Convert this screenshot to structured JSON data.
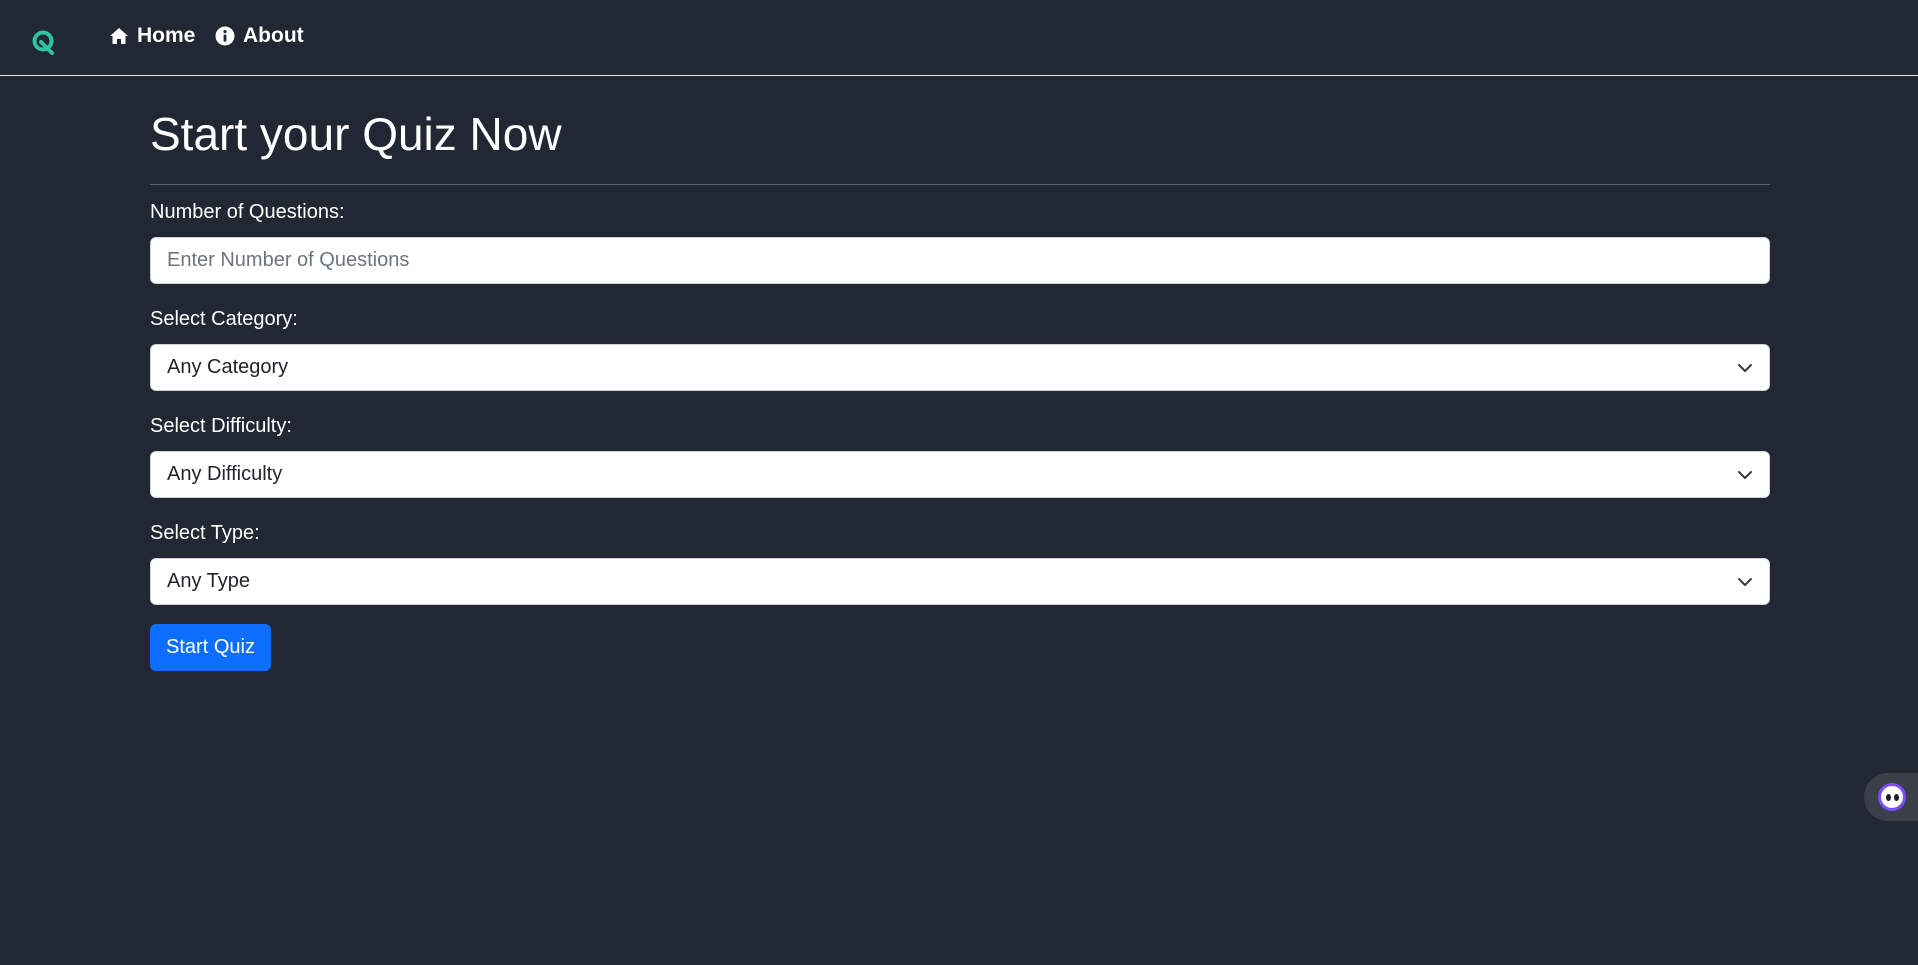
{
  "nav": {
    "logo_icon": "quiz-logo-icon",
    "brand_color": "#2ec4a0",
    "links": [
      {
        "label": "Home",
        "icon": "home-icon"
      },
      {
        "label": "About",
        "icon": "info-icon"
      }
    ]
  },
  "main": {
    "title": "Start your Quiz Now",
    "fields": {
      "questions": {
        "label": "Number of Questions:",
        "placeholder": "Enter Number of Questions",
        "value": ""
      },
      "category": {
        "label": "Select Category:",
        "selected": "Any Category"
      },
      "difficulty": {
        "label": "Select Difficulty:",
        "selected": "Any Difficulty"
      },
      "type": {
        "label": "Select Type:",
        "selected": "Any Type"
      }
    },
    "submit_label": "Start Quiz",
    "submit_color": "#0d6efd"
  },
  "widget": {
    "icon": "assistant-face-icon"
  }
}
